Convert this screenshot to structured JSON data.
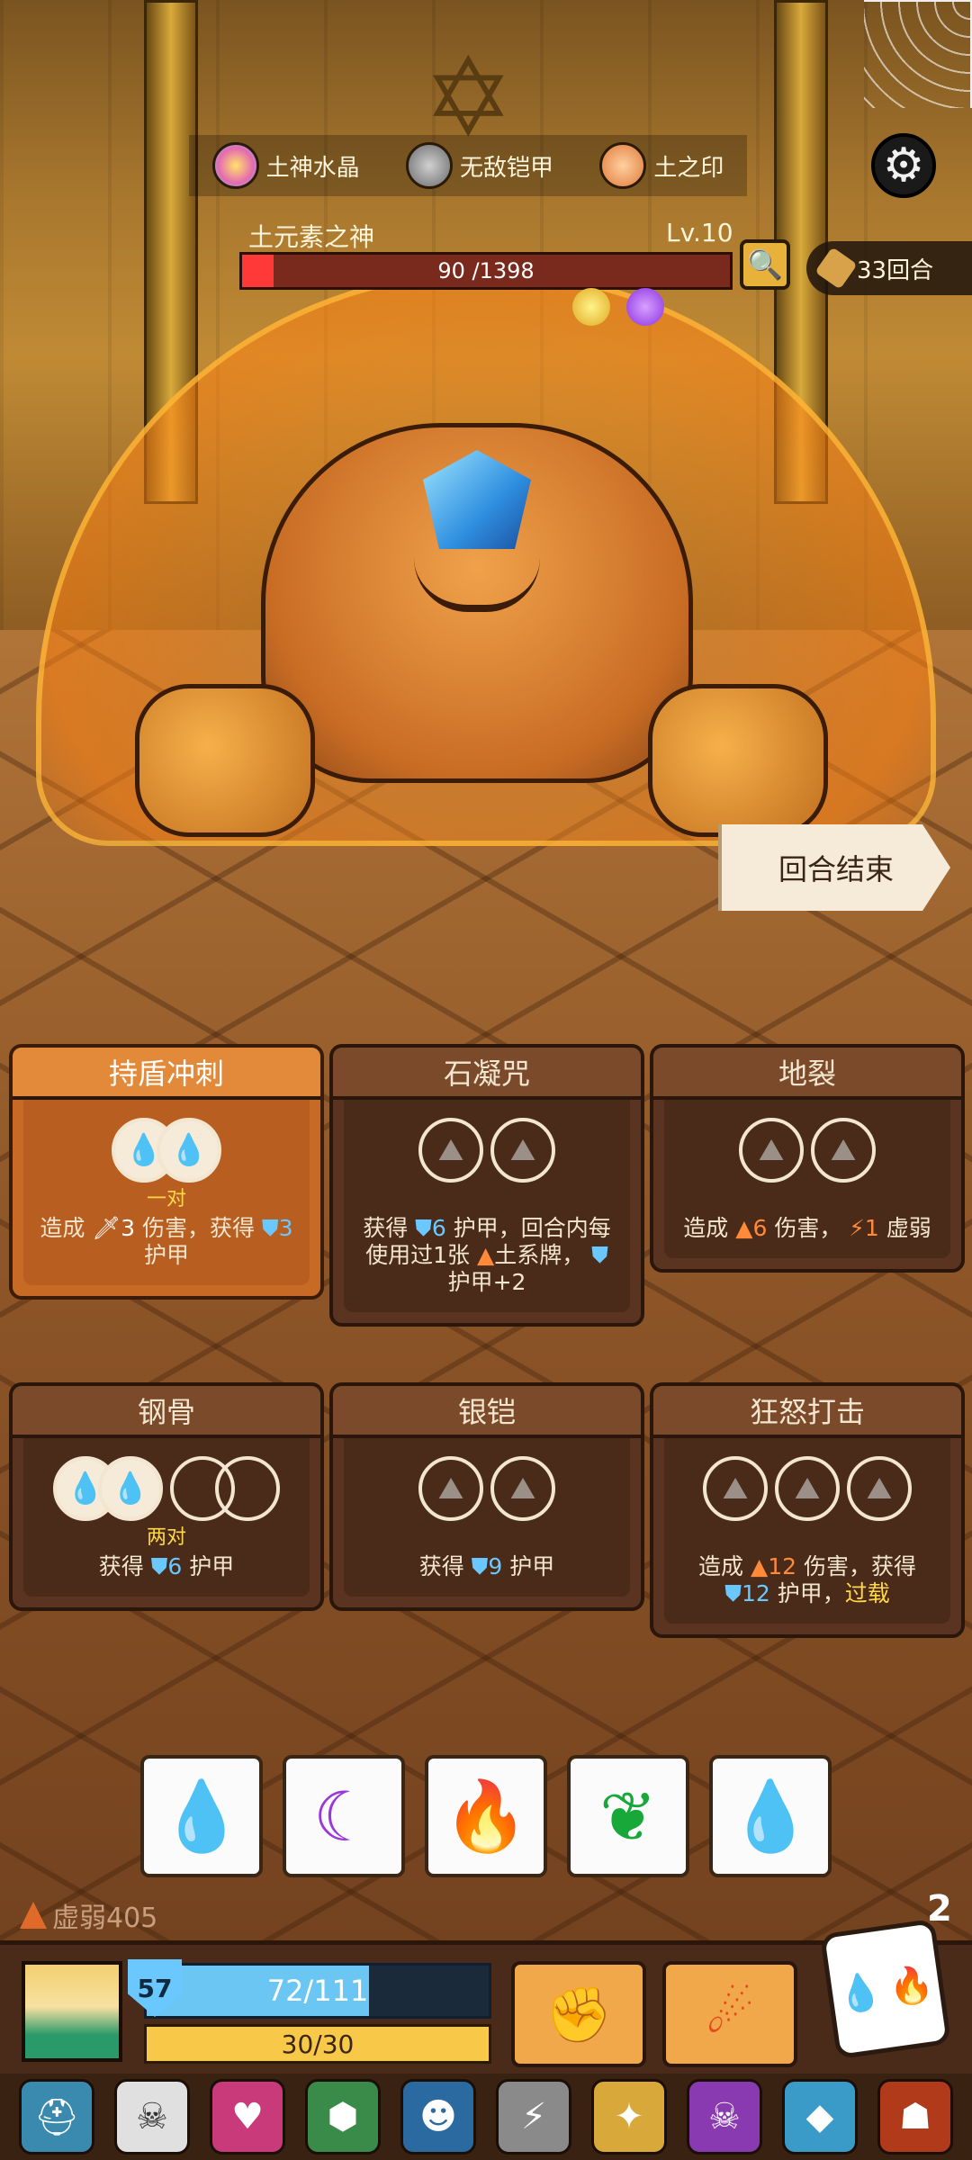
{
  "top_bar": {
    "resources": [
      {
        "icon": "earth-crystal-icon",
        "label": "土神水晶"
      },
      {
        "icon": "invincible-armor-icon",
        "label": "无敌铠甲"
      },
      {
        "icon": "earth-seal-icon",
        "label": "土之印"
      }
    ],
    "settings_icon": "gear-icon"
  },
  "boss": {
    "name": "土元素之神",
    "level": "Lv.10",
    "hp_text": "90 /1398",
    "hp_fraction": 0.064,
    "status_icons": [
      "gold-buff-icon",
      "purple-debuff-icon"
    ]
  },
  "turn": {
    "label": "33回合"
  },
  "end_turn_label": "回合结束",
  "cards": [
    {
      "title": "持盾冲刺",
      "active": true,
      "rule": "一对",
      "desc": [
        "造成 ",
        {
          "c": "hl-sword",
          "t": "🗡3"
        },
        " 伤害，获得 ",
        {
          "c": "hl-shield",
          "t": "⛊3"
        },
        " 护甲"
      ]
    },
    {
      "title": "石凝咒",
      "active": false,
      "rule": "",
      "desc": [
        "获得 ",
        {
          "c": "hl-shield",
          "t": "⛊6"
        },
        " 护甲，回合内每使用过1张 ",
        {
          "c": "hl-earth",
          "t": "▲"
        },
        "土系牌， ",
        {
          "c": "hl-shield",
          "t": "⛊"
        },
        " 护甲+2"
      ]
    },
    {
      "title": "地裂",
      "active": false,
      "rule": "",
      "desc": [
        "造成 ",
        {
          "c": "hl-earth",
          "t": "▲6"
        },
        " 伤害，  ",
        {
          "c": "hl-weak",
          "t": "⚡1"
        },
        " 虚弱"
      ]
    },
    {
      "title": "钢骨",
      "active": false,
      "rule": "两对",
      "desc": [
        "获得 ",
        {
          "c": "hl-shield",
          "t": "⛊6"
        },
        " 护甲"
      ]
    },
    {
      "title": "银铠",
      "active": false,
      "rule": "",
      "desc": [
        "获得 ",
        {
          "c": "hl-shield",
          "t": "⛊9"
        },
        " 护甲"
      ]
    },
    {
      "title": "狂怒打击",
      "active": false,
      "rule": "",
      "desc": [
        "造成 ",
        {
          "c": "hl-earth",
          "t": "▲12"
        },
        " 伤害，获得 ",
        {
          "c": "hl-shield",
          "t": "⛊12"
        },
        " 护甲，",
        {
          "c": "hl-overload",
          "t": "过载"
        }
      ]
    }
  ],
  "dice": [
    "water",
    "moon",
    "fire",
    "leaf",
    "water"
  ],
  "debuff": {
    "label": "虚弱405"
  },
  "dice_remaining": "2",
  "player": {
    "shield": "57",
    "hp_text": "72/111",
    "hp_fraction": 0.649,
    "energy_text": "30/30",
    "energy_fraction": 1.0
  },
  "skills": [
    "spiked-fist-icon",
    "flame-strike-icon"
  ],
  "relics": [
    "helmet-relic-icon",
    "bull-skull-relic-icon",
    "heart-relic-icon",
    "turtle-shell-relic-icon",
    "demon-mask-relic-icon",
    "lightning-orb-relic-icon",
    "totem-mask-relic-icon",
    "skull-book-relic-icon",
    "crystal-shield-relic-icon",
    "hooded-figure-relic-icon"
  ],
  "colors": {
    "boss_hp": "#ff3838",
    "player_hp": "#6cc6f4",
    "energy": "#f8c848",
    "active_card": "#c66a26",
    "card": "#5a3420"
  }
}
